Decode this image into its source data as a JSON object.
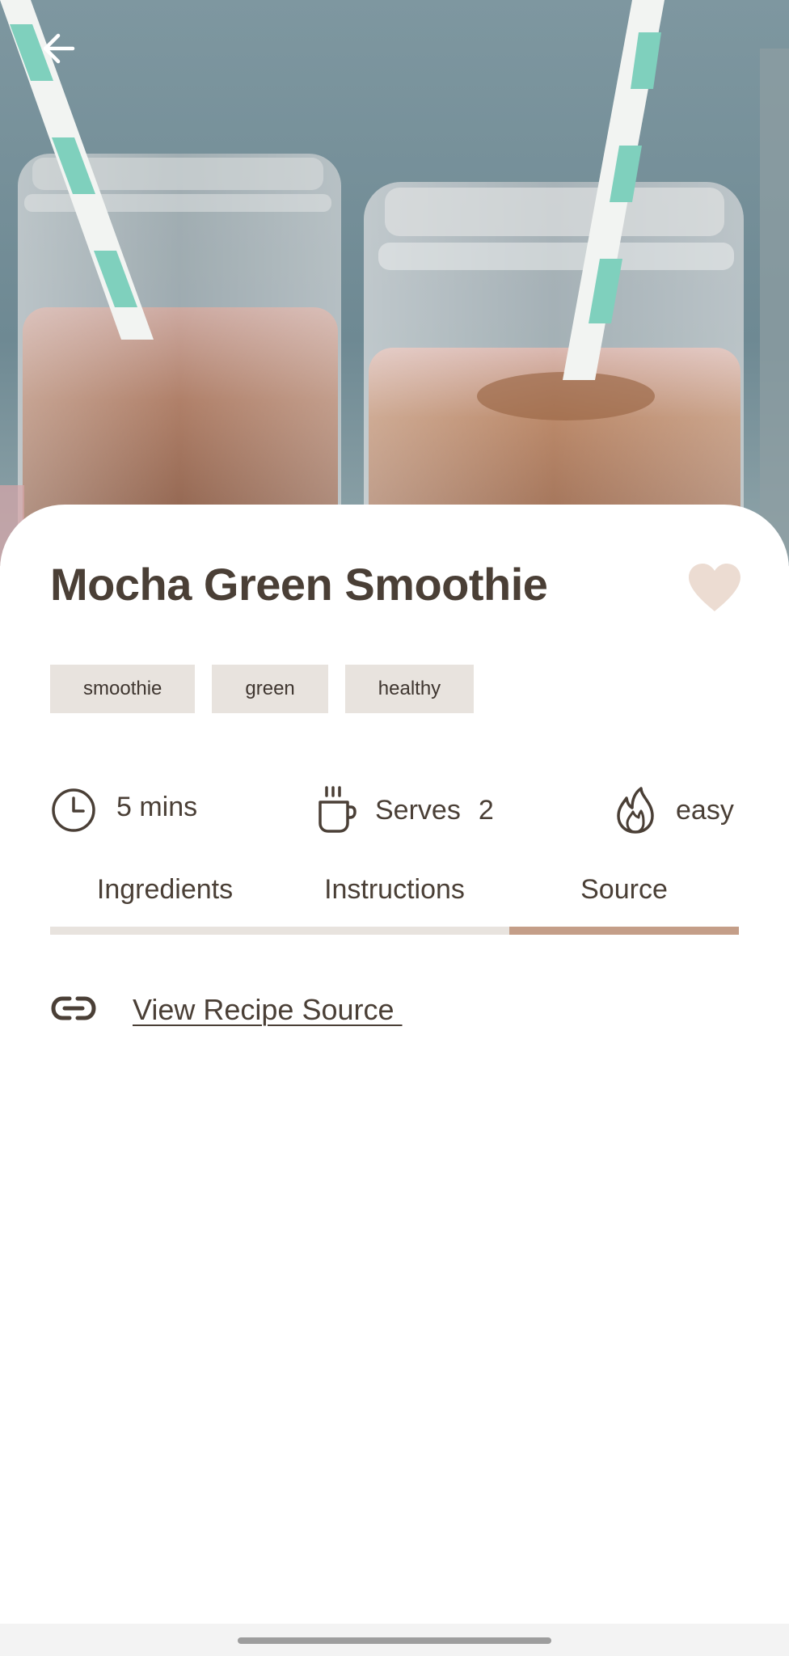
{
  "hero": {
    "back_icon": "arrow-left-icon",
    "image_subject": "mocha-smoothie-jars"
  },
  "recipe": {
    "title": "Mocha Green Smoothie",
    "favorite_icon": "heart-icon",
    "favorite_color": "#ecdcd2",
    "tags": [
      "smoothie",
      "green",
      "healthy"
    ],
    "time": {
      "icon": "clock-icon",
      "label": "5 mins"
    },
    "serves": {
      "icon": "mug-icon",
      "label": "Serves",
      "value": "2"
    },
    "difficulty": {
      "icon": "flame-icon",
      "label": "easy"
    }
  },
  "tabs": {
    "items": [
      {
        "label": "Ingredients",
        "active": false
      },
      {
        "label": "Instructions",
        "active": false
      },
      {
        "label": "Source",
        "active": true
      }
    ],
    "active_index": 2,
    "track_color": "#e8e3de",
    "indicator_color": "#c49e88"
  },
  "source": {
    "icon": "link-icon",
    "link_label": "View Recipe Source "
  },
  "colors": {
    "text": "#4a3f36",
    "tag_background": "#e8e3de"
  }
}
